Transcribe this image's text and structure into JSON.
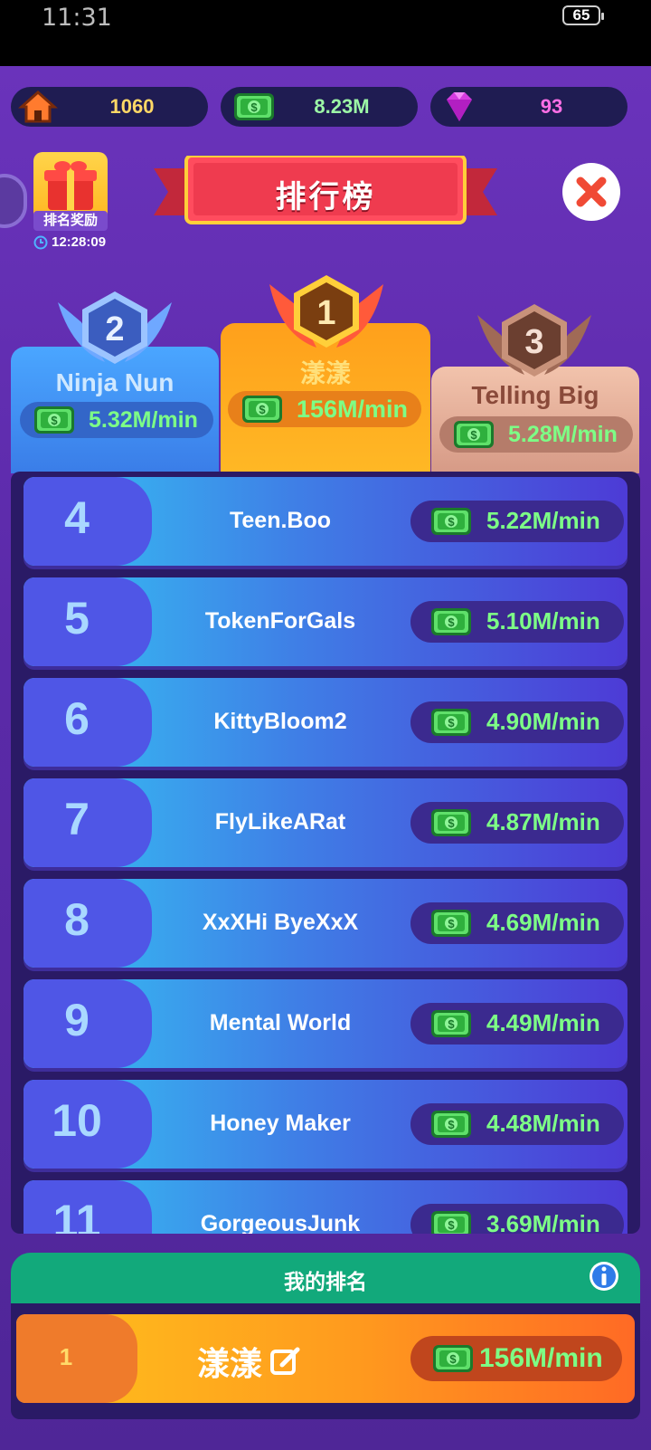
{
  "status_bar": {
    "time": "11:31",
    "battery": "65"
  },
  "currencies": {
    "home": "1060",
    "cash": "8.23M",
    "gems": "93"
  },
  "rewards": {
    "label": "排名奖励",
    "timer": "12:28:09"
  },
  "title": "排行榜",
  "podium": [
    {
      "rank": "1",
      "name": "漾漾",
      "rate": "156M/min"
    },
    {
      "rank": "2",
      "name": "Ninja Nun",
      "rate": "5.32M/min"
    },
    {
      "rank": "3",
      "name": "Telling Big",
      "rate": "5.28M/min"
    }
  ],
  "leaderboard": [
    {
      "rank": "4",
      "name": "Teen.Boo",
      "rate": "5.22M/min"
    },
    {
      "rank": "5",
      "name": "TokenForGals",
      "rate": "5.10M/min"
    },
    {
      "rank": "6",
      "name": "KittyBloom2",
      "rate": "4.90M/min"
    },
    {
      "rank": "7",
      "name": "FlyLikeARat",
      "rate": "4.87M/min"
    },
    {
      "rank": "8",
      "name": "XxXHi ByeXxX",
      "rate": "4.69M/min"
    },
    {
      "rank": "9",
      "name": "Mental World",
      "rate": "4.49M/min"
    },
    {
      "rank": "10",
      "name": "Honey Maker",
      "rate": "4.48M/min"
    },
    {
      "rank": "11",
      "name": "GorgeousJunk",
      "rate": "3.69M/min"
    }
  ],
  "my_ranking": {
    "title": "我的排名",
    "rank": "1",
    "name": "漾漾",
    "rate": "156M/min"
  },
  "colors": {
    "background": "#5a2aa8",
    "gold_podium": "#ffa61f",
    "silver_podium": "#3f8ef0",
    "bronze_podium": "#d9a892",
    "rate_green": "#7dff86",
    "my_bar": "#12a97b"
  }
}
